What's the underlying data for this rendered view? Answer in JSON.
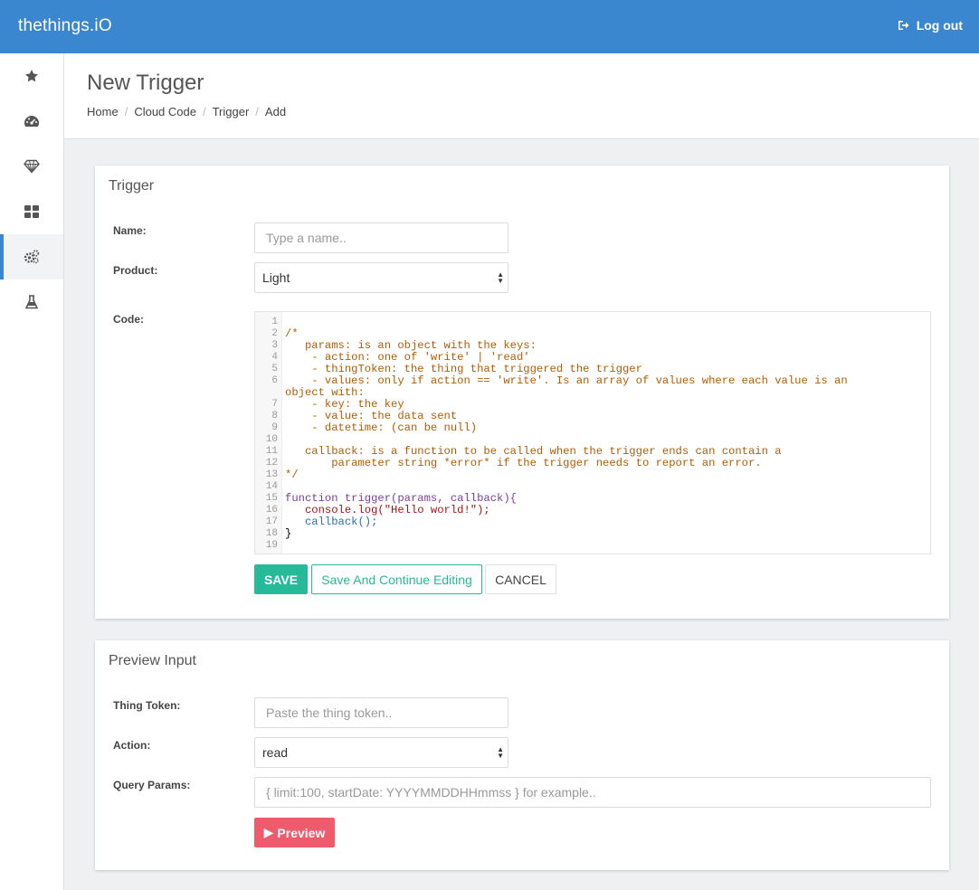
{
  "app": {
    "logo": "thethings.iO",
    "logout_label": "Log out"
  },
  "sidebar": {
    "items": [
      {
        "icon": "star-icon",
        "active": false
      },
      {
        "icon": "dashboard-icon",
        "active": false
      },
      {
        "icon": "diamond-icon",
        "active": false
      },
      {
        "icon": "grid-icon",
        "active": false
      },
      {
        "icon": "gears-icon",
        "active": true
      },
      {
        "icon": "flask-icon",
        "active": false
      }
    ]
  },
  "header": {
    "title": "New Trigger",
    "breadcrumb": [
      "Home",
      "Cloud Code",
      "Trigger",
      "Add"
    ]
  },
  "trigger_panel": {
    "title": "Trigger",
    "name_label": "Name:",
    "name_placeholder": "Type a name..",
    "name_value": "",
    "product_label": "Product:",
    "product_value": "Light",
    "code_label": "Code:",
    "code_lines": [
      "",
      "/*",
      "   params: is an object with the keys:",
      "    - action: one of 'write' | 'read'",
      "    - thingToken: the thing that triggered the trigger",
      "    - values: only if action == 'write'. Is an array of values where each value is an",
      "object with:",
      "    - key: the key",
      "    - value: the data sent",
      "    - datetime: (can be null)",
      "",
      "   callback: is a function to be called when the trigger ends can contain a",
      "       parameter string *error* if the trigger needs to report an error.",
      "*/",
      "",
      "function trigger(params, callback){",
      "   console.log(\"Hello world!\");",
      "   callback();",
      "}",
      ""
    ],
    "line_numbers": [
      "1",
      "2",
      "3",
      "4",
      "5",
      "6",
      "",
      "7",
      "8",
      "9",
      "10",
      "11",
      "12",
      "13",
      "14",
      "15",
      "16",
      "17",
      "18",
      "19"
    ],
    "save_label": "SAVE",
    "continue_label": "Save And Continue Editing",
    "cancel_label": "CANCEL"
  },
  "preview_panel": {
    "title": "Preview Input",
    "token_label": "Thing Token:",
    "token_placeholder": "Paste the thing token..",
    "action_label": "Action:",
    "action_value": "read",
    "query_label": "Query Params:",
    "query_placeholder": "{ limit:100, startDate: YYYYMMDDHHmmss } for example..",
    "preview_label": "Preview"
  },
  "colors": {
    "topbar": "#3a87d0",
    "save": "#26b99a",
    "preview": "#ee5b6d"
  }
}
